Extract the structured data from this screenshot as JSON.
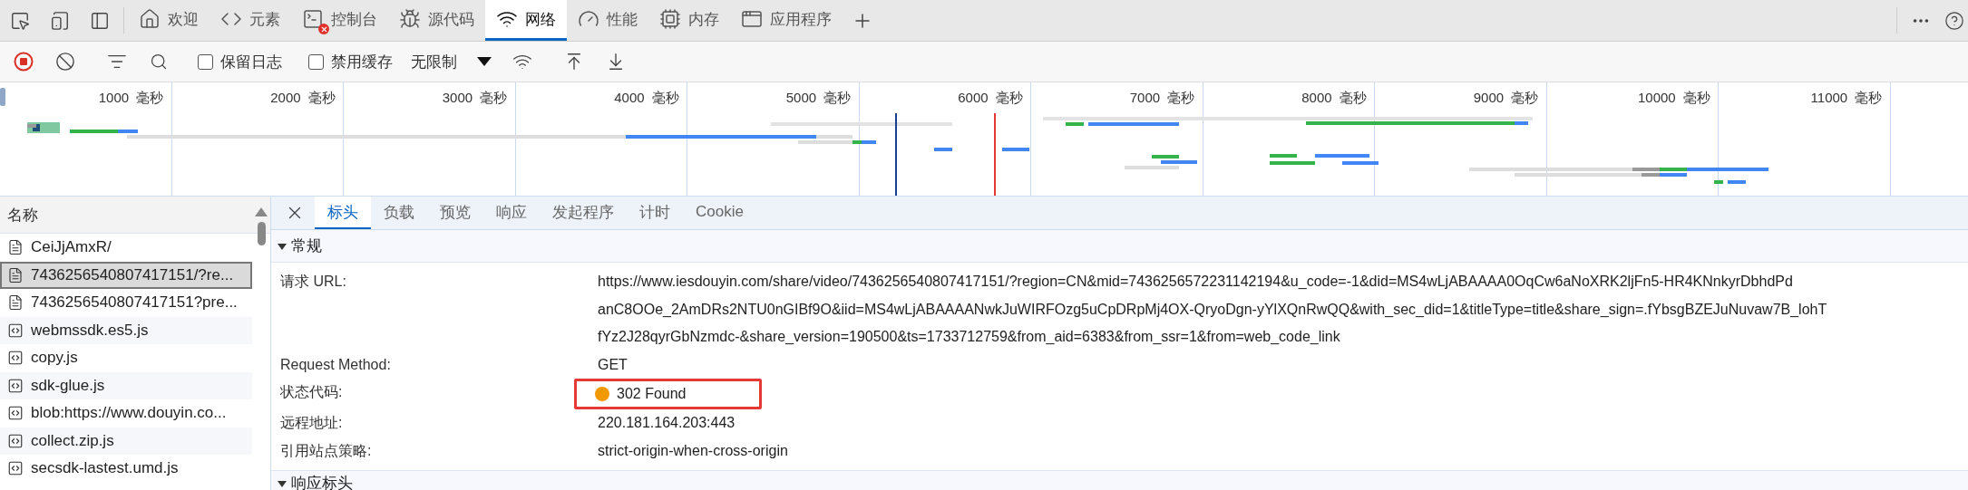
{
  "top_tabs": [
    {
      "label": "欢迎",
      "selected": false,
      "has_error": false
    },
    {
      "label": "元素",
      "selected": false,
      "has_error": false
    },
    {
      "label": "控制台",
      "selected": false,
      "has_error": true
    },
    {
      "label": "源代码",
      "selected": false,
      "has_error": false
    },
    {
      "label": "网络",
      "selected": true,
      "has_error": false
    },
    {
      "label": "性能",
      "selected": false,
      "has_error": false
    },
    {
      "label": "内存",
      "selected": false,
      "has_error": false
    },
    {
      "label": "应用程序",
      "selected": false,
      "has_error": false
    }
  ],
  "toolbar": {
    "recording": true,
    "checkboxes": [
      {
        "label": "保留日志",
        "checked": false
      },
      {
        "label": "禁用缓存",
        "checked": false
      }
    ],
    "throttle": "无限制"
  },
  "timeline": {
    "ticks": [
      "1000  毫秒",
      "2000  毫秒",
      "3000  毫秒",
      "4000  毫秒",
      "5000  毫秒",
      "6000  毫秒",
      "7000  毫秒",
      "8000  毫秒",
      "9000  毫秒",
      "10000  毫秒",
      "11000  毫秒"
    ]
  },
  "requests": {
    "header": "名称",
    "items": [
      {
        "name": "CeiJjAmxR/",
        "kind": "document",
        "selected": false
      },
      {
        "name": "7436256540807417151/?re...",
        "kind": "document",
        "selected": true
      },
      {
        "name": "7436256540807417151?pre...",
        "kind": "document",
        "selected": false
      },
      {
        "name": "webmssdk.es5.js",
        "kind": "script",
        "selected": false
      },
      {
        "name": "copy.js",
        "kind": "script",
        "selected": false
      },
      {
        "name": "sdk-glue.js",
        "kind": "script",
        "selected": false
      },
      {
        "name": "blob:https://www.douyin.co...",
        "kind": "script",
        "selected": false
      },
      {
        "name": "collect.zip.js",
        "kind": "script",
        "selected": false
      },
      {
        "name": "secsdk-lastest.umd.js",
        "kind": "script",
        "selected": false
      }
    ]
  },
  "detail_tabs": [
    {
      "label": "标头",
      "selected": true
    },
    {
      "label": "负载",
      "selected": false
    },
    {
      "label": "预览",
      "selected": false
    },
    {
      "label": "响应",
      "selected": false
    },
    {
      "label": "发起程序",
      "selected": false
    },
    {
      "label": "计时",
      "selected": false
    },
    {
      "label": "Cookie",
      "selected": false
    }
  ],
  "general": {
    "title": "常规",
    "expanded": true,
    "rows": [
      {
        "label": "请求 URL:",
        "value_lines": [
          "https://www.iesdouyin.com/share/video/7436256540807417151/?region=CN&mid=7436256572231142194&u_code=-1&did=MS4wLjABAAAA0OqCw6aNoXRK2ljFn5-HR4KNnkyrDbhdPd",
          "anC8OOe_2AmDRs2NTU0nGIBf9O&iid=MS4wLjABAAAANwkJuWIRFOzg5uCpDRpMj4OX-QryoDgn-yYlXQnRwQQ&with_sec_did=1&titleType=title&share_sign=.fYbsgBZEJuNuvaw7B_lohT",
          "fYz2J28qyrGbNzmdc-&share_version=190500&ts=1733712759&from_aid=6383&from_ssr=1&from=web_code_link"
        ],
        "highlighted": false
      },
      {
        "label": "Request Method:",
        "value_lines": [
          "GET"
        ],
        "highlighted": false
      },
      {
        "label": "状态代码:",
        "value_lines": [
          "302 Found"
        ],
        "color": "#f29900",
        "highlighted": true
      },
      {
        "label": "远程地址:",
        "value_lines": [
          "220.181.164.203:443"
        ],
        "highlighted": false
      },
      {
        "label": "引用站点策略:",
        "value_lines": [
          "strict-origin-when-cross-origin"
        ],
        "highlighted": false
      }
    ]
  },
  "response_headers": {
    "title": "响应标头",
    "expanded": true
  }
}
